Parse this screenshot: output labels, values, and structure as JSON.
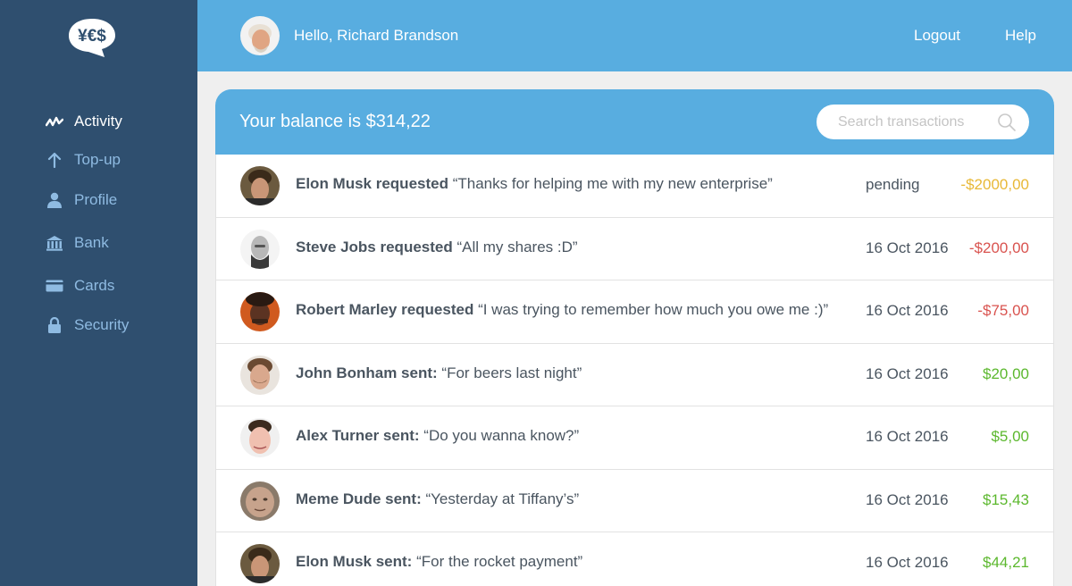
{
  "app": {
    "logo_text": "¥€$"
  },
  "sidebar": {
    "items": [
      {
        "label": "Activity",
        "icon": "activity-icon",
        "active": true
      },
      {
        "label": "Top-up",
        "icon": "arrow-up-icon",
        "active": false
      },
      {
        "label": "Profile",
        "icon": "user-icon",
        "active": false
      },
      {
        "label": "Bank",
        "icon": "bank-icon",
        "active": false
      },
      {
        "label": "Cards",
        "icon": "card-icon",
        "active": false
      },
      {
        "label": "Security",
        "icon": "lock-icon",
        "active": false
      }
    ]
  },
  "header": {
    "greeting": "Hello, Richard Brandson",
    "logout_label": "Logout",
    "help_label": "Help"
  },
  "balance": {
    "text": "Your balance is $314,22"
  },
  "search": {
    "placeholder": "Search transactions"
  },
  "transactions": [
    {
      "name": "Elon Musk requested",
      "message": "“Thanks for helping me with my new enterprise”",
      "status": "pending",
      "amount": "-$2000,00",
      "amount_color": "#e8b836"
    },
    {
      "name": "Steve Jobs requested",
      "message": "“All my shares :D”",
      "status": "16 Oct 2016",
      "amount": "-$200,00",
      "amount_color": "#d9534f"
    },
    {
      "name": "Robert Marley requested",
      "message": "“I was trying to remember how much you owe me :)”",
      "status": "16 Oct 2016",
      "amount": "-$75,00",
      "amount_color": "#d9534f"
    },
    {
      "name": "John Bonham sent:",
      "message": "“For beers last night”",
      "status": "16 Oct 2016",
      "amount": "$20,00",
      "amount_color": "#5cb82e"
    },
    {
      "name": "Alex Turner sent:",
      "message": "“Do you wanna know?”",
      "status": "16 Oct 2016",
      "amount": "$5,00",
      "amount_color": "#5cb82e"
    },
    {
      "name": "Meme Dude sent:",
      "message": "“Yesterday at Tiffany’s”",
      "status": "16 Oct 2016",
      "amount": "$15,43",
      "amount_color": "#5cb82e"
    },
    {
      "name": "Elon Musk sent:",
      "message": "“For the rocket payment”",
      "status": "16 Oct 2016",
      "amount": "$44,21",
      "amount_color": "#5cb82e"
    }
  ],
  "colors": {
    "sidebar_bg": "#2f4f6f",
    "accent": "#58ade0",
    "nav_inactive": "#8fbbe2",
    "pending": "#e8b836",
    "negative": "#d9534f",
    "positive": "#5cb82e"
  }
}
